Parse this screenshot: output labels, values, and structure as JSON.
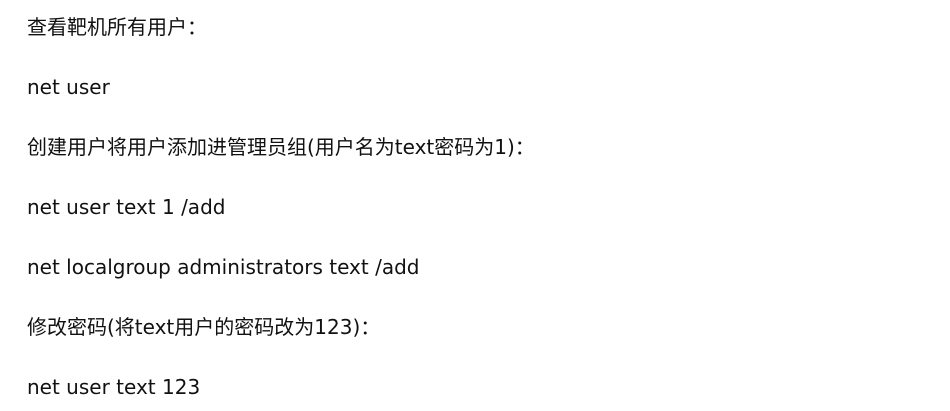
{
  "lines": [
    "查看靶机所有用户：",
    "net user",
    "创建用户将用户添加进管理员组(用户名为text密码为1)：",
    "net user text 1 /add",
    "net localgroup administrators text /add",
    "修改密码(将text用户的密码改为123)：",
    "net user text 123"
  ]
}
